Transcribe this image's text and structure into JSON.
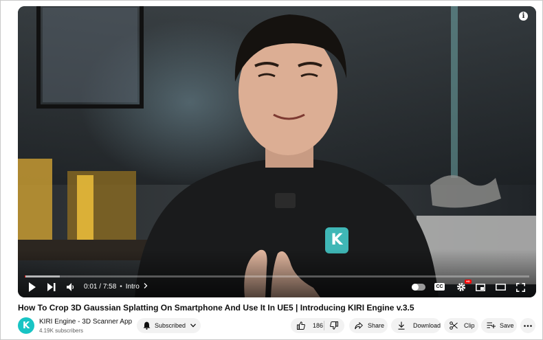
{
  "video": {
    "time_current": "0:01",
    "time_separator": "/",
    "time_total": "7:58",
    "chapter_sep": "•",
    "chapter": "Intro",
    "progress_fraction": 0.002,
    "buffered_fraction": 0.07,
    "cc_label": "CC",
    "hd_label": "HD",
    "info_label": "i",
    "shirt_logo": "K"
  },
  "title": "How To Crop 3D Gaussian Splatting On Smartphone And Use It In UE5 | Introducing KIRI Engine v.3.5",
  "channel": {
    "name": "KIRI Engine - 3D Scanner App",
    "subscribers": "4.19K subscribers",
    "avatar_letter": "K",
    "avatar_color": "#18c4c4"
  },
  "actions": {
    "subscribed_label": "Subscribed",
    "likes": "186",
    "share_label": "Share",
    "download_label": "Download",
    "clip_label": "Clip",
    "save_label": "Save"
  },
  "icons": [
    "play-icon",
    "next-icon",
    "volume-icon",
    "autoplay-toggle",
    "cc-icon",
    "settings-icon",
    "miniplayer-icon",
    "theater-icon",
    "fullscreen-icon",
    "bell-icon",
    "chevron-down-icon",
    "thumbs-up-icon",
    "thumbs-down-icon",
    "share-icon",
    "download-icon",
    "scissors-icon",
    "playlist-add-icon",
    "more-icon",
    "info-icon"
  ],
  "colors": {
    "progress": "#ff0000",
    "pill_bg": "#f2f2f2",
    "brand": "#18c4c4"
  }
}
